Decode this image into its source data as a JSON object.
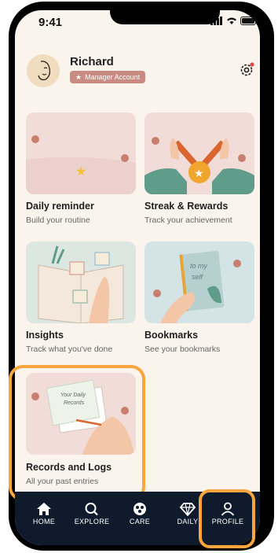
{
  "status_bar": {
    "time": "9:41"
  },
  "profile": {
    "name": "Richard",
    "role_badge": "Manager Account"
  },
  "cards": [
    {
      "title": "Daily reminder",
      "subtitle": "Build your routine"
    },
    {
      "title": "Streak & Rewards",
      "subtitle": "Track your achievement"
    },
    {
      "title": "Insights",
      "subtitle": "Track what you've done"
    },
    {
      "title": "Bookmarks",
      "subtitle": "See your bookmarks"
    },
    {
      "title": "Records and Logs",
      "subtitle": "All your past entries"
    }
  ],
  "nav": [
    {
      "label": "HOME",
      "icon": "home-icon"
    },
    {
      "label": "EXPLORE",
      "icon": "search-icon"
    },
    {
      "label": "CARE",
      "icon": "care-icon"
    },
    {
      "label": "DAILY",
      "icon": "diamond-icon"
    },
    {
      "label": "PROFILE",
      "icon": "person-icon",
      "active": true
    }
  ],
  "colors": {
    "accent": "#f8a53e",
    "badge": "#c98a82",
    "nav_bg": "#0f1b2d",
    "card_bg": "#f2dcd7"
  }
}
